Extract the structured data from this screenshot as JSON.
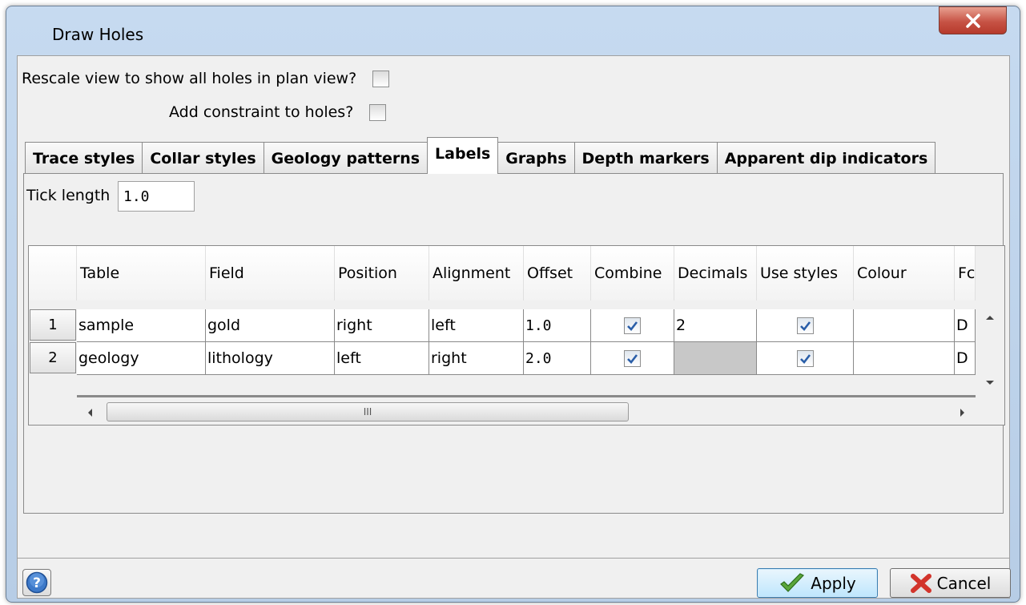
{
  "window": {
    "title": "Draw Holes"
  },
  "options": {
    "rescale_label": "Rescale view to show all holes in plan view?",
    "rescale_checked": false,
    "constraint_label": "Add constraint to holes?",
    "constraint_checked": false
  },
  "tabs": [
    {
      "label": "Trace styles",
      "active": false
    },
    {
      "label": "Collar styles",
      "active": false
    },
    {
      "label": "Geology patterns",
      "active": false
    },
    {
      "label": "Labels",
      "active": true
    },
    {
      "label": "Graphs",
      "active": false
    },
    {
      "label": "Depth markers",
      "active": false
    },
    {
      "label": "Apparent dip indicators",
      "active": false
    }
  ],
  "labels_tab": {
    "tick_length_label": "Tick length",
    "tick_length_value": "1.0",
    "columns": [
      "Table",
      "Field",
      "Position",
      "Alignment",
      "Offset",
      "Combine",
      "Decimals",
      "Use styles",
      "Colour",
      "Fc"
    ],
    "rows": [
      {
        "num": "1",
        "table": "sample",
        "field": "gold",
        "position": "right",
        "alignment": "left",
        "offset": "1.0",
        "combine": true,
        "decimals": "2",
        "use_styles": true,
        "colour": "",
        "font": "D"
      },
      {
        "num": "2",
        "table": "geology",
        "field": "lithology",
        "position": "left",
        "alignment": "right",
        "offset": "2.0",
        "combine": true,
        "decimals": "",
        "use_styles": true,
        "colour": "",
        "font": "D"
      }
    ],
    "scroll_thumb_glyph": "III"
  },
  "buttons": {
    "apply": "Apply",
    "cancel": "Cancel"
  },
  "colors": {
    "title_bg": "#c6daf0",
    "close_red": "#c75345",
    "apply_blue": "#bee6fd",
    "disabled_cell": "#c8c8c8"
  }
}
